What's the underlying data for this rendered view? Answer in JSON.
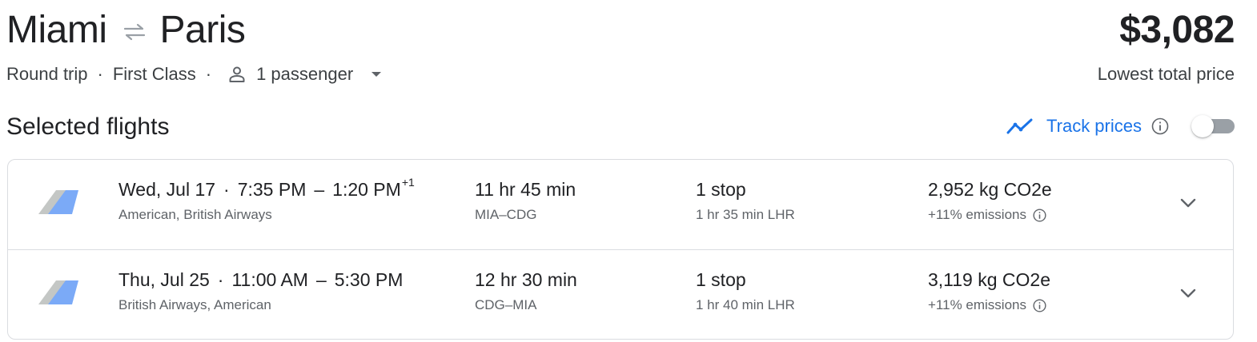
{
  "route": {
    "origin": "Miami",
    "destination": "Paris",
    "swap_icon": "swap-arrows-icon"
  },
  "summary": {
    "trip_type": "Round trip",
    "cabin_class": "First Class",
    "passenger_icon": "person-icon",
    "passengers": "1 passenger",
    "dropdown_icon": "caret-down-icon"
  },
  "price": {
    "amount": "$3,082",
    "label": "Lowest total price"
  },
  "section": {
    "title": "Selected flights"
  },
  "track_prices": {
    "icon": "trend-line-icon",
    "label": "Track prices",
    "info_icon": "info-icon",
    "enabled": false
  },
  "flights": [
    {
      "date": "Wed, Jul 17",
      "separator": "·",
      "departure": "7:35 PM",
      "dash": "–",
      "arrival": "1:20 PM",
      "day_offset": "+1",
      "airlines": "American, British Airways",
      "duration": "11 hr 45 min",
      "airports": "MIA–CDG",
      "stops": "1 stop",
      "layover": "1 hr 35 min LHR",
      "emissions": "2,952 kg CO2e",
      "emissions_delta": "+11% emissions"
    },
    {
      "date": "Thu, Jul 25",
      "separator": "·",
      "departure": "11:00 AM",
      "dash": "–",
      "arrival": "5:30 PM",
      "day_offset": "",
      "airlines": "British Airways, American",
      "duration": "12 hr 30 min",
      "airports": "CDG–MIA",
      "stops": "1 stop",
      "layover": "1 hr 40 min LHR",
      "emissions": "3,119 kg CO2e",
      "emissions_delta": "+11% emissions"
    }
  ],
  "colors": {
    "accent": "#1a73e8",
    "text_primary": "#202124",
    "text_secondary": "#5f6368",
    "border": "#dadce0",
    "toggle_off": "#9aa0a6"
  }
}
